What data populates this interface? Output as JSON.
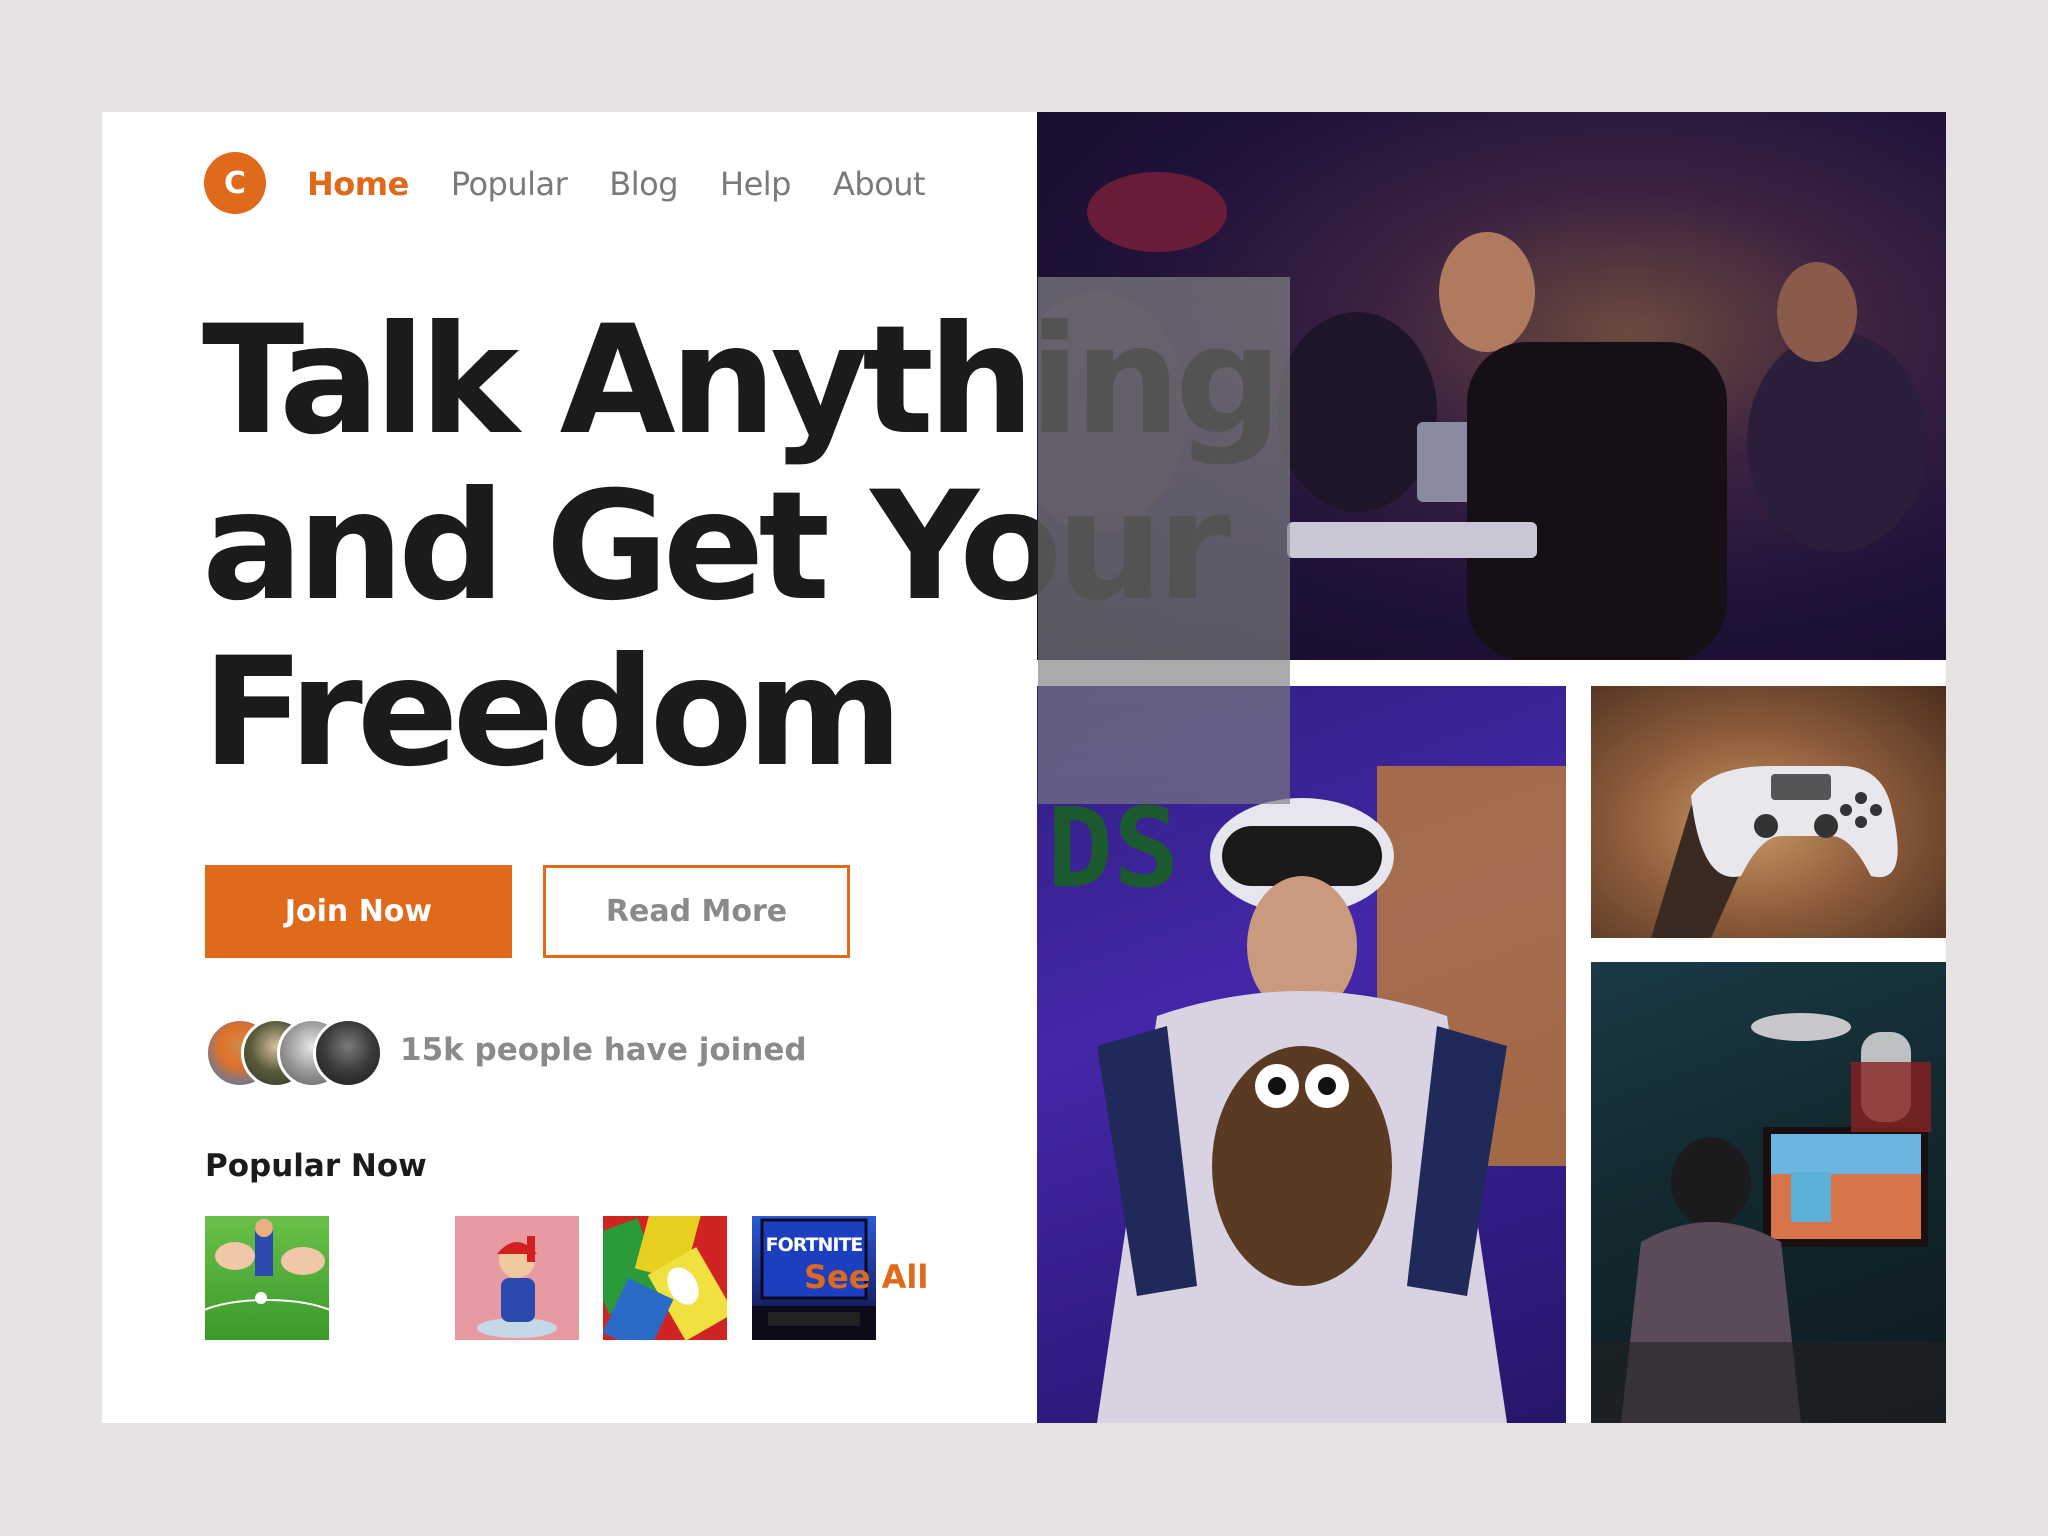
{
  "brand": {
    "logo_letter": "C",
    "accent": "#e06a1b"
  },
  "nav": [
    {
      "label": "Home",
      "active": true
    },
    {
      "label": "Popular",
      "active": false
    },
    {
      "label": "Blog",
      "active": false
    },
    {
      "label": "Help",
      "active": false
    },
    {
      "label": "About",
      "active": false
    }
  ],
  "hero": {
    "lines": [
      "Talk Anything",
      "and Get Your",
      "Freedom"
    ]
  },
  "buttons": {
    "join": "Join Now",
    "read_more": "Read More"
  },
  "community": {
    "joined_text": "15k people have joined"
  },
  "popular": {
    "title": "Popular Now",
    "thumb_text": "FORTNITE",
    "see_all": "See All"
  }
}
